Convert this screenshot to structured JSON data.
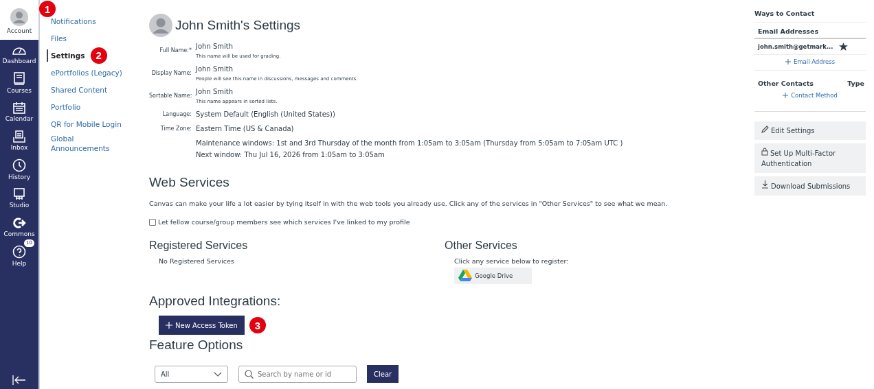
{
  "global_nav": [
    {
      "label": "Account",
      "selected": true
    },
    {
      "label": "Dashboard",
      "selected": false
    },
    {
      "label": "Courses",
      "selected": false
    },
    {
      "label": "Calendar",
      "selected": false
    },
    {
      "label": "Inbox",
      "selected": false
    },
    {
      "label": "History",
      "selected": false
    },
    {
      "label": "Studio",
      "selected": false
    },
    {
      "label": "Commons",
      "selected": false
    },
    {
      "label": "Help",
      "selected": false,
      "badge": "10"
    }
  ],
  "account_nav": [
    {
      "label": "Notifications",
      "selected": false
    },
    {
      "label": "Files",
      "selected": false
    },
    {
      "label": "Settings",
      "selected": true
    },
    {
      "label": "ePortfolios (Legacy)",
      "selected": false
    },
    {
      "label": "Shared Content",
      "selected": false
    },
    {
      "label": "Portfolio",
      "selected": false
    },
    {
      "label": "QR for Mobile Login",
      "selected": false
    },
    {
      "label": "Global Announcements",
      "selected": false
    }
  ],
  "callouts": [
    "1",
    "2",
    "3"
  ],
  "profile": {
    "title": "John Smith's Settings",
    "fields": [
      {
        "label": "Full Name:*",
        "value": "John Smith",
        "hint": "This name will be used for grading."
      },
      {
        "label": "Display Name:",
        "value": "John Smith",
        "hint": "People will see this name in discussions, messages and comments."
      },
      {
        "label": "Sortable Name:",
        "value": "John Smith",
        "hint": "This name appears in sorted lists."
      },
      {
        "label": "Language:",
        "value": "System Default (English (United States))"
      },
      {
        "label": "Time Zone:",
        "value": "Eastern Time (US & Canada)"
      }
    ],
    "maintenance": [
      "Maintenance windows: 1st and 3rd Thursday of the month from 1:05am to 3:05am (Thursday from 5:05am to 7:05am UTC )",
      "Next window: Thu Jul 16, 2026 from 1:05am to 3:05am"
    ]
  },
  "web_services": {
    "heading": "Web Services",
    "intro": "Canvas can make your life a lot easier by tying itself in with the web tools you already use. Click any of the services in \"Other Services\" to see what we mean.",
    "share_checkbox": {
      "label": "Let fellow course/group members see which services I've linked to my profile",
      "checked": false
    },
    "registered": {
      "heading": "Registered Services",
      "empty": "No Registered Services"
    },
    "other": {
      "heading": "Other Services",
      "hint": "Click any service below to register:",
      "services": [
        "Google Drive"
      ]
    }
  },
  "approved_integrations": {
    "heading": "Approved Integrations:",
    "button": "New Access Token"
  },
  "feature_options": {
    "heading": "Feature Options",
    "filter": "All",
    "search": {
      "placeholder": "Search by name or id"
    },
    "clear": "Clear"
  },
  "ways_to_contact": {
    "heading": "Ways to Contact",
    "email_heading": "Email Addresses",
    "emails": [
      {
        "address": "john.smith@getmark...",
        "default": true
      }
    ],
    "add_email": "Email Address",
    "other_heading": "Other Contacts",
    "type_heading": "Type",
    "add_contact": "Contact Method"
  },
  "actions": [
    "Edit Settings",
    "Set Up Multi-Factor Authentication",
    "Download Submissions"
  ]
}
